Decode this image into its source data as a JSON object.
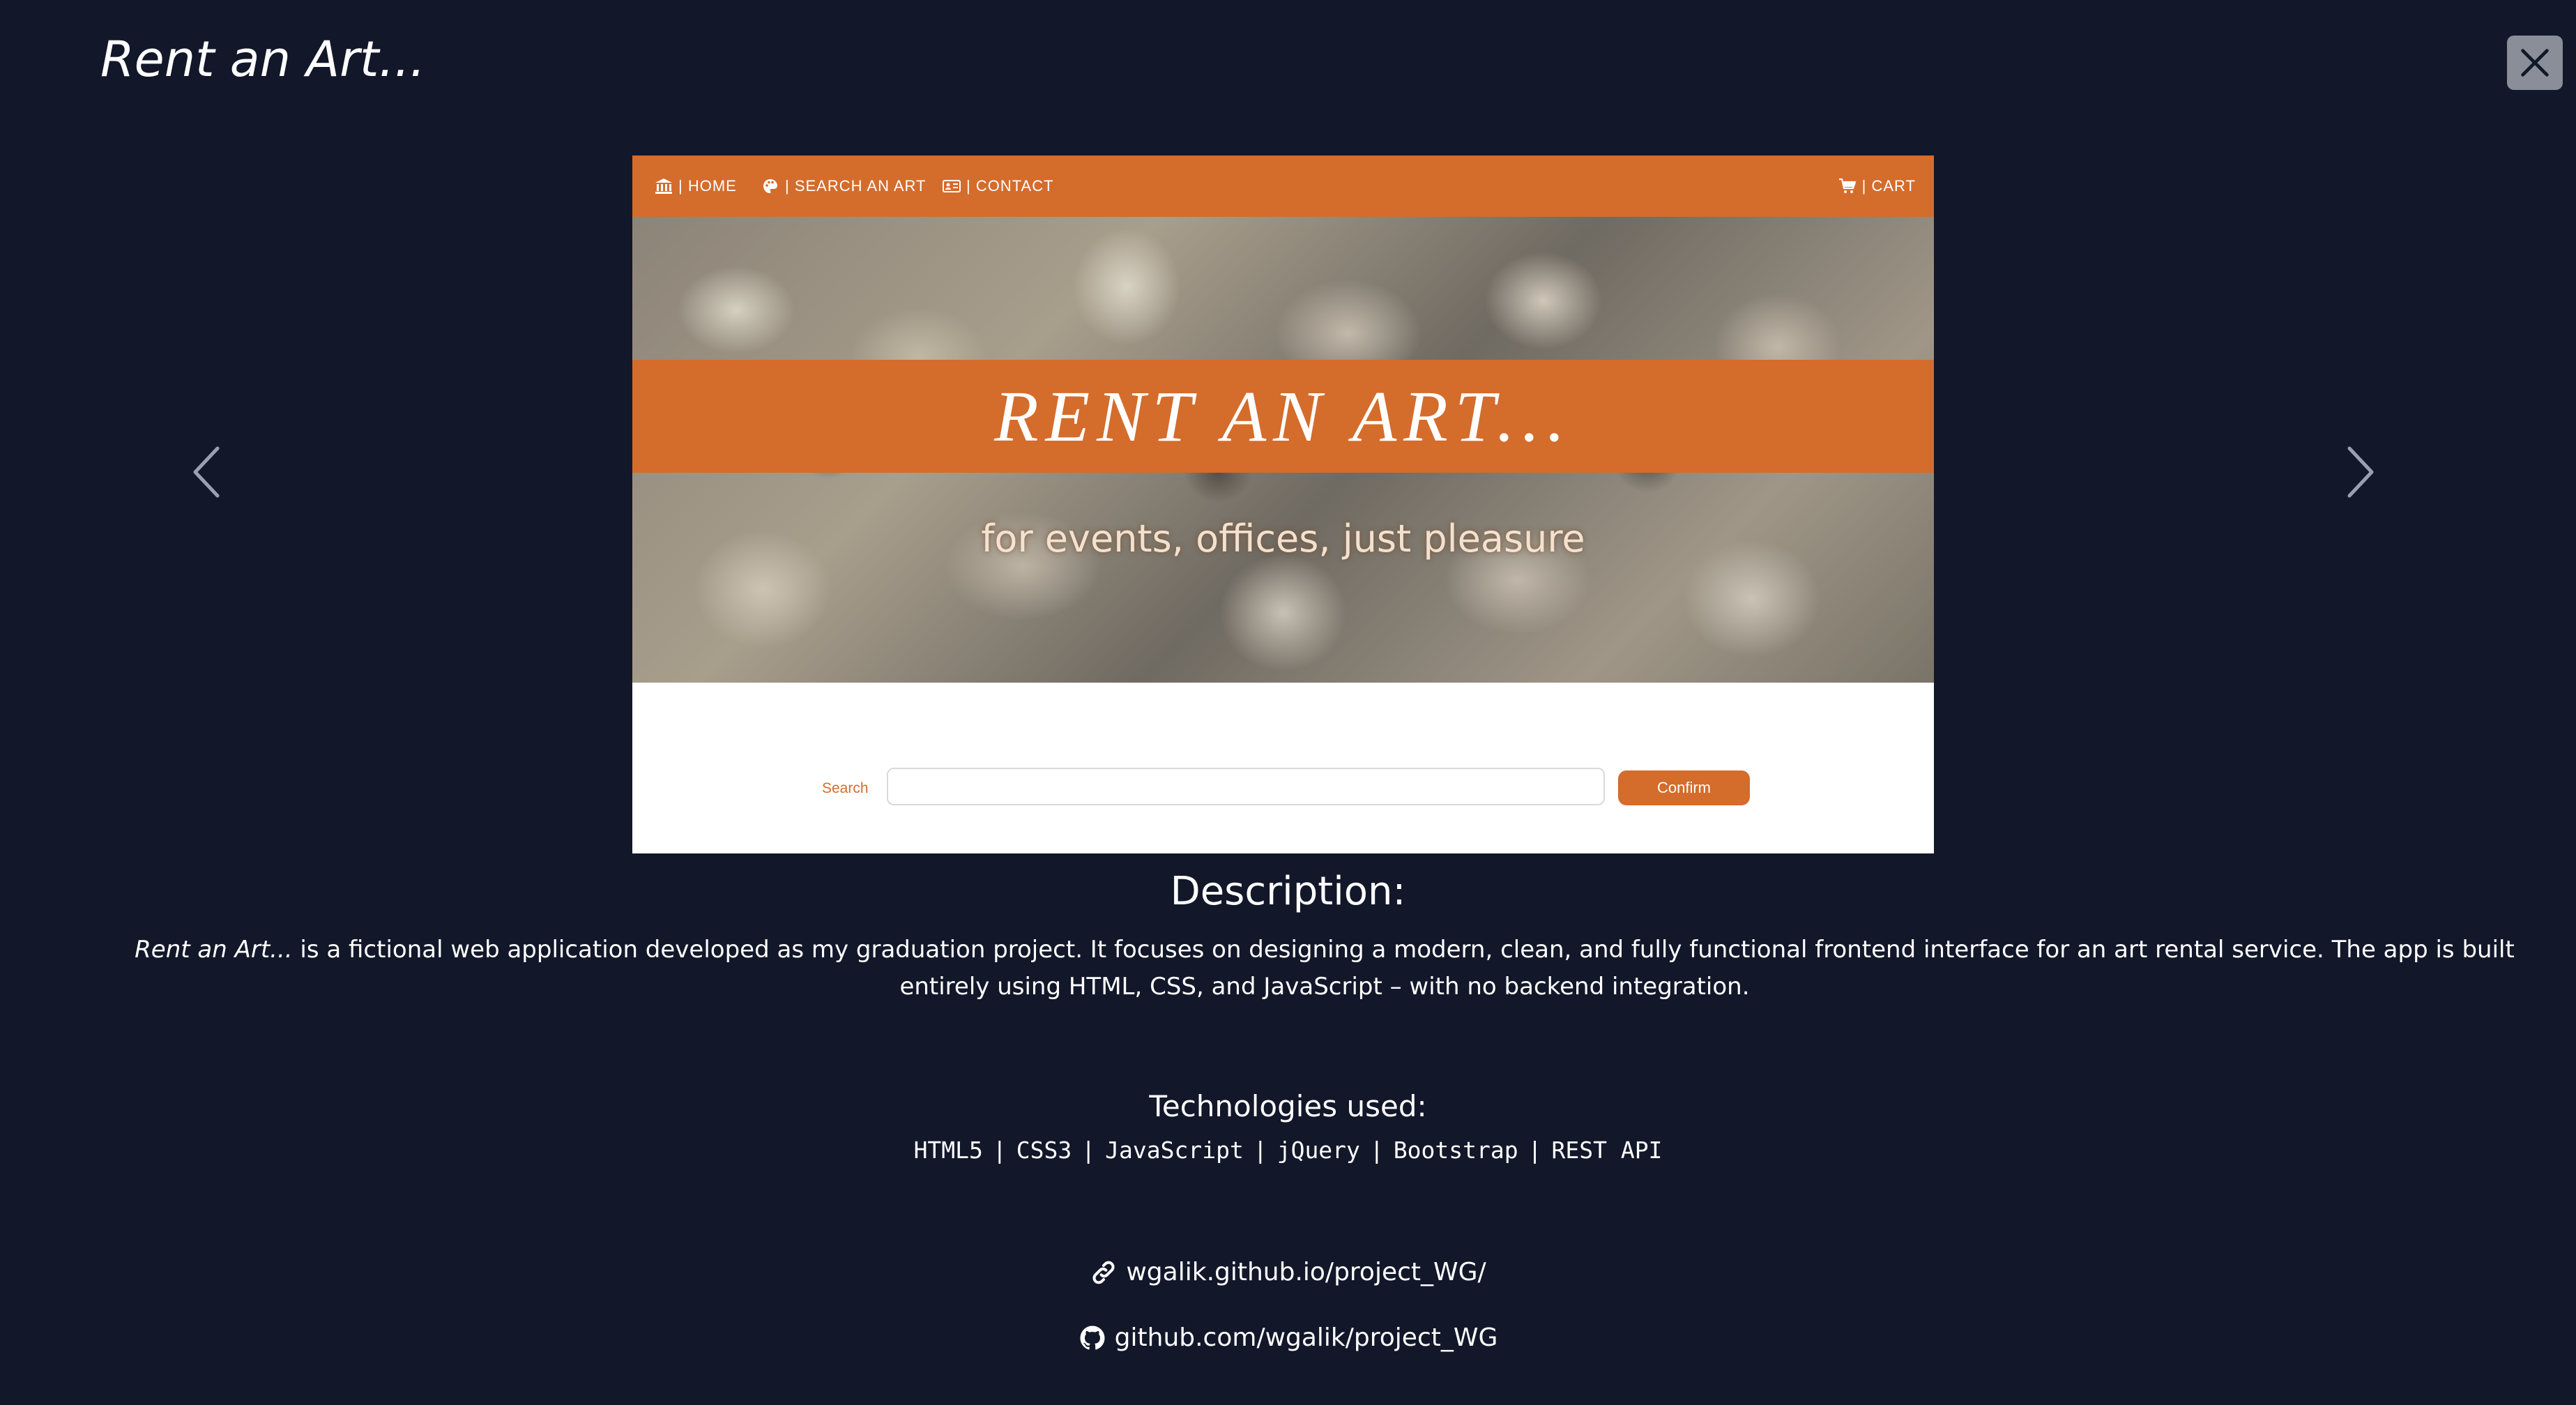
{
  "modal": {
    "title": "Rent an Art...",
    "close_icon": "close-icon"
  },
  "navigation": {
    "prev_icon": "chevron-left-icon",
    "next_icon": "chevron-right-icon"
  },
  "preview": {
    "nav": {
      "home": "| HOME",
      "search": "| SEARCH AN ART",
      "contact": "| CONTACT",
      "cart": "| CART",
      "icons": [
        "bank-icon",
        "palette-icon",
        "contact-card-icon",
        "cart-icon"
      ]
    },
    "hero_title": "RENT AN ART...",
    "hero_subtitle": "for events, offices, just pleasure",
    "search_label": "Search",
    "search_value": "",
    "confirm_label": "Confirm",
    "accent_color": "#d46c2c"
  },
  "description": {
    "heading": "Description:",
    "project_name": "Rent an Art...",
    "text": " is a fictional web application developed as my graduation project. It focuses on designing a modern, clean, and fully functional frontend interface for an art rental service. The app is built entirely using HTML, CSS, and JavaScript – with no backend integration."
  },
  "technologies": {
    "heading": "Technologies used:",
    "items": [
      "HTML5",
      "CSS3",
      "JavaScript",
      "jQuery",
      "Bootstrap",
      "REST API"
    ],
    "separator": "|"
  },
  "links": {
    "live": {
      "text": "wgalik.github.io/project_WG/",
      "icon": "link-icon"
    },
    "repo": {
      "text": "github.com/wgalik/project_WG",
      "icon": "github-icon"
    }
  },
  "colors": {
    "background": "#12172a",
    "accent": "#d46c2c",
    "close_button": "#8a8e99"
  }
}
